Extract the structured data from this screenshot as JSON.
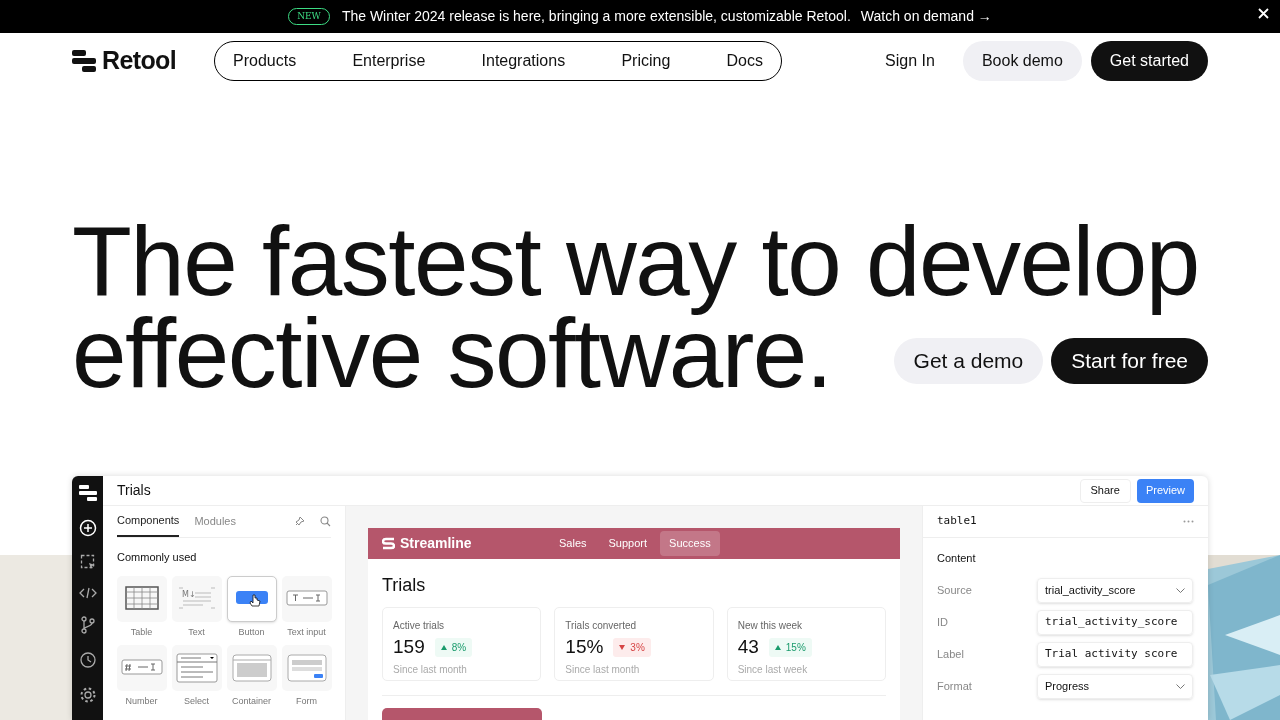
{
  "banner": {
    "badge": "NEW",
    "text": "The Winter 2024 release is here, bringing a more extensible, customizable Retool.",
    "link": "Watch on demand →"
  },
  "nav": {
    "logo": "Retool",
    "links": [
      "Products",
      "Enterprise",
      "Integrations",
      "Pricing",
      "Docs"
    ],
    "sign_in": "Sign In",
    "book_demo": "Book demo",
    "get_started": "Get started"
  },
  "hero": {
    "lines": [
      "The fastest way to develop",
      "effective software."
    ],
    "secondary_button": "Get a demo",
    "primary_button": "Start for free"
  },
  "app": {
    "title": "Trials",
    "share": "Share",
    "preview": "Preview",
    "panel_tabs": [
      {
        "label": "Components",
        "selected": true
      },
      {
        "label": "Modules",
        "selected": false
      }
    ],
    "section": "Commonly used",
    "components": [
      {
        "label": "Table",
        "kind": "table",
        "hovered": false
      },
      {
        "label": "Text",
        "kind": "text",
        "hovered": false,
        "icon_text": "M↓"
      },
      {
        "label": "Button",
        "kind": "button",
        "hovered": true
      },
      {
        "label": "Text input",
        "kind": "text_input",
        "hovered": false
      },
      {
        "label": "Number",
        "kind": "number_input",
        "hovered": false
      },
      {
        "label": "Select",
        "kind": "select",
        "hovered": false
      },
      {
        "label": "Container",
        "kind": "container",
        "hovered": false
      },
      {
        "label": "Form",
        "kind": "form",
        "hovered": false
      }
    ],
    "preview_app": {
      "brand": "Streamline",
      "tabs": [
        {
          "label": "Sales",
          "selected": false
        },
        {
          "label": "Support",
          "selected": false
        },
        {
          "label": "Success",
          "selected": true
        }
      ],
      "heading": "Trials",
      "stats": [
        {
          "label": "Active trials",
          "value": "159",
          "delta": "8%",
          "rising": true,
          "note": "Since last month"
        },
        {
          "label": "Trials converted",
          "value": "15%",
          "delta": "3%",
          "rising": false,
          "note": "Since last month"
        },
        {
          "label": "New this week",
          "value": "43",
          "delta": "15%",
          "rising": true,
          "note": "Since last week"
        }
      ]
    },
    "inspector": {
      "name": "table1",
      "section": "Content",
      "fields": [
        {
          "label": "Source",
          "value": "trial_activity_score",
          "kind": "select"
        },
        {
          "label": "ID",
          "value": "trial_activity_score",
          "kind": "code"
        },
        {
          "label": "Label",
          "value": "Trial activity score",
          "kind": "code"
        },
        {
          "label": "Format",
          "value": "Progress",
          "kind": "select"
        }
      ]
    }
  }
}
